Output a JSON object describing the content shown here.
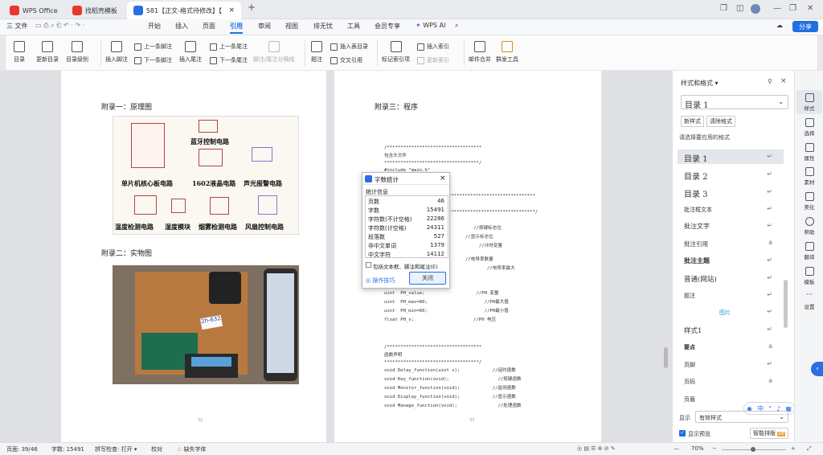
{
  "tabs": [
    {
      "label": "WPS Office"
    },
    {
      "label": "找稻壳模板"
    },
    {
      "label": "581【正文-格式待修改】【"
    }
  ],
  "menu": {
    "file": "三 文件",
    "items": [
      "开始",
      "插入",
      "页面",
      "引用",
      "审阅",
      "视图",
      "排无忧",
      "工具",
      "会员专享"
    ],
    "ai": "WPS AI",
    "share": "分享"
  },
  "ribbon": {
    "toc": "目录",
    "update_toc": "更新目录",
    "toc_level": "目录级别",
    "insert_footnote": "插入脚注",
    "prev_footnote": "上一条脚注",
    "next_footnote": "下一条脚注",
    "insert_endnote": "插入尾注",
    "prev_endnote": "上一条尾注",
    "next_endnote": "下一条尾注",
    "note_separator": "脚注/尾注分隔线",
    "caption": "题注",
    "insert_table_of_figures": "插入表目录",
    "cross_reference": "交叉引用",
    "mark_index": "标记索引项",
    "insert_index": "插入索引",
    "update_index": "更新索引",
    "mail_merge": "邮件合并",
    "envelope_tools": "群发工具"
  },
  "left_page": {
    "appendix1": "附录一：原理图",
    "labels": [
      "单片机核心板电路",
      "蓝牙控制电路",
      "1602液晶电路",
      "声光报警电路",
      "温度检测电路",
      "湿度模块",
      "烟雾检测电路",
      "风扇控制电路"
    ],
    "appendix2": "附录二：实物图",
    "sticker": "2h-632",
    "page_num": "32"
  },
  "right_page": {
    "appendix3": "附录三：程序",
    "page_num": "33",
    "code_lines": [
      "/***********************************",
      "包含头文件",
      "***********************************/",
      "#include \"main.h\"",
      "***********************************",
      "***********************************/",
      "                                 //按键标志位",
      "                              //显示标志位",
      "                                   //计时变量",
      "                              //电导率数量",
      "                                      //电导率最大",
      "uint  PH_value;                   //PH 变量",
      "uint  PH_max=80;                     //PH最大值",
      "uint  PH_min=60;                     //PH最小值",
      "float PH_v;                      //PH 电压",
      "/***********************************",
      "函数声明",
      "***********************************/",
      "void Delay_function(uint x);            //延时函数",
      "void Key_function(void);                  //按键函数",
      "void Monitor_function(void);            //监测函数",
      "void Display_function(void);            //显示函数",
      "void Manage_function(void);               //处理函数"
    ]
  },
  "dialog": {
    "title": "字数统计",
    "section": "统计信息",
    "rows": [
      [
        "页数",
        "46"
      ],
      [
        "字数",
        "15491"
      ],
      [
        "字符数(不计空格)",
        "22286"
      ],
      [
        "字符数(计空格)",
        "24311"
      ],
      [
        "段落数",
        "527"
      ],
      [
        "非中文单词",
        "1379"
      ],
      [
        "中文字符",
        "14112"
      ]
    ],
    "checkbox": "包括文本框、脚注和尾注(E)",
    "tips": "操作技巧",
    "close": "关闭"
  },
  "panel": {
    "title": "样式和格式",
    "current": "目录 1",
    "new_style": "新样式",
    "clear_format": "清除格式",
    "hint": "请选择要应用的格式",
    "styles": [
      "目录 1",
      "目录 2",
      "目录 3",
      "批注框文本",
      "批注文字",
      "批注引用",
      "批注主题",
      "普通(网站)",
      "题注",
      "图片",
      "样式1",
      "要点",
      "页脚",
      "页码",
      "页眉"
    ],
    "show_label": "显示",
    "show_value": "有效样式",
    "preview": "显示预览",
    "smart": "智能排版"
  },
  "rightbar": [
    "样式",
    "选择",
    "属性",
    "素材",
    "美化",
    "帮助",
    "翻译",
    "模板",
    "设置"
  ],
  "status": {
    "page": "页面: 39/46",
    "words": "字数: 15491",
    "spell": "拼写检查: 打开",
    "proof": "校对",
    "font": "缺失字体",
    "zoom": "70%"
  }
}
